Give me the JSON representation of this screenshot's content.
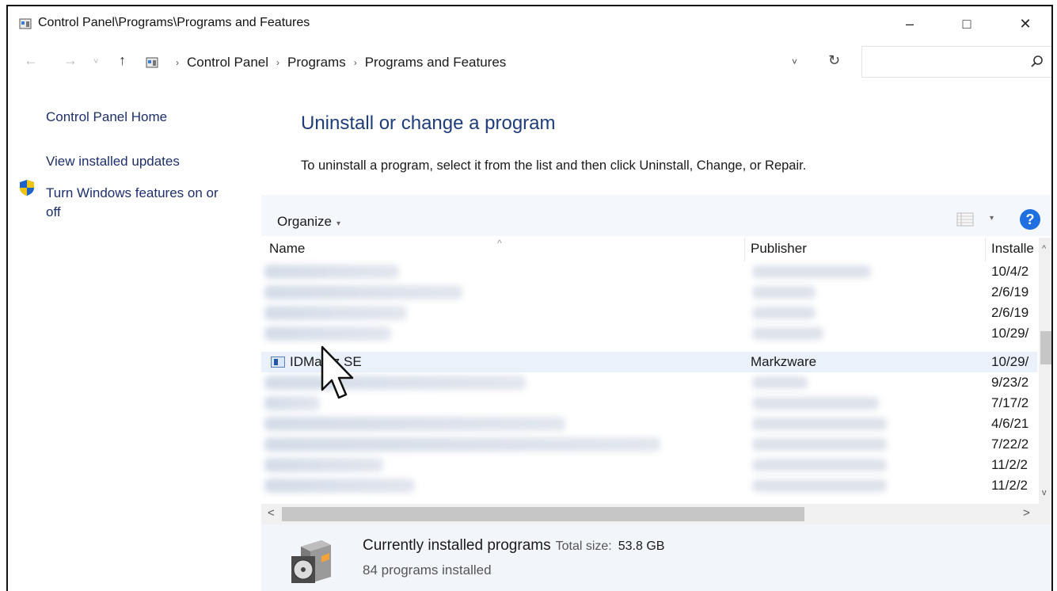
{
  "window": {
    "title": "Control Panel\\Programs\\Programs and Features",
    "min_glyph": "–",
    "max_glyph": "□",
    "close_glyph": "✕"
  },
  "nav": {
    "back_glyph": "←",
    "forward_glyph": "→",
    "recent_glyph": "˅",
    "up_glyph": "↑",
    "breadcrumb": [
      "Control Panel",
      "Programs",
      "Programs and Features"
    ],
    "crumb_separator": "›",
    "dropdown_glyph": "˅",
    "refresh_glyph": "↻",
    "search_placeholder": ""
  },
  "sidebar": {
    "home": "Control Panel Home",
    "updates": "View installed updates",
    "features_line1": "Turn Windows features on or",
    "features_line2": "off"
  },
  "main": {
    "heading": "Uninstall or change a program",
    "instructions": "To uninstall a program, select it from the list and then click Uninstall, Change, or Repair."
  },
  "toolbar": {
    "organize": "Organize",
    "organize_arrow": "▾",
    "view_arrow": "▾",
    "help": "?"
  },
  "list": {
    "columns": {
      "name": "Name",
      "publisher": "Publisher",
      "installed": "Installe"
    },
    "sort_caret": "^",
    "rows": [
      {
        "name": "",
        "publisher": "",
        "installed": "10/4/2"
      },
      {
        "name": "",
        "publisher": "",
        "installed": "2/6/19"
      },
      {
        "name": "",
        "publisher": "",
        "installed": "2/6/19"
      },
      {
        "name": "",
        "publisher": "",
        "installed": "10/29/"
      },
      {
        "name": "IDMarkz SE",
        "publisher": "Markzware",
        "installed": "10/29/"
      },
      {
        "name": "",
        "publisher": "",
        "installed": "9/23/2"
      },
      {
        "name": "",
        "publisher": "",
        "installed": "7/17/2"
      },
      {
        "name": "",
        "publisher": "",
        "installed": "4/6/21"
      },
      {
        "name": "",
        "publisher": "",
        "installed": "7/22/2"
      },
      {
        "name": "",
        "publisher": "",
        "installed": "11/2/2"
      },
      {
        "name": "",
        "publisher": "",
        "installed": "11/2/2"
      }
    ],
    "scroll_up": "^",
    "scroll_down": "v",
    "scroll_left": "<",
    "scroll_right": ">"
  },
  "footer": {
    "title": "Currently installed programs",
    "size_label": "Total size:",
    "size_value": "53.8 GB",
    "count": "84 programs installed"
  },
  "colors": {
    "link": "#1e2f6b",
    "heading": "#1e3d7a",
    "selected_row": "#eaf1fb",
    "help_blue": "#1f6fe0"
  }
}
